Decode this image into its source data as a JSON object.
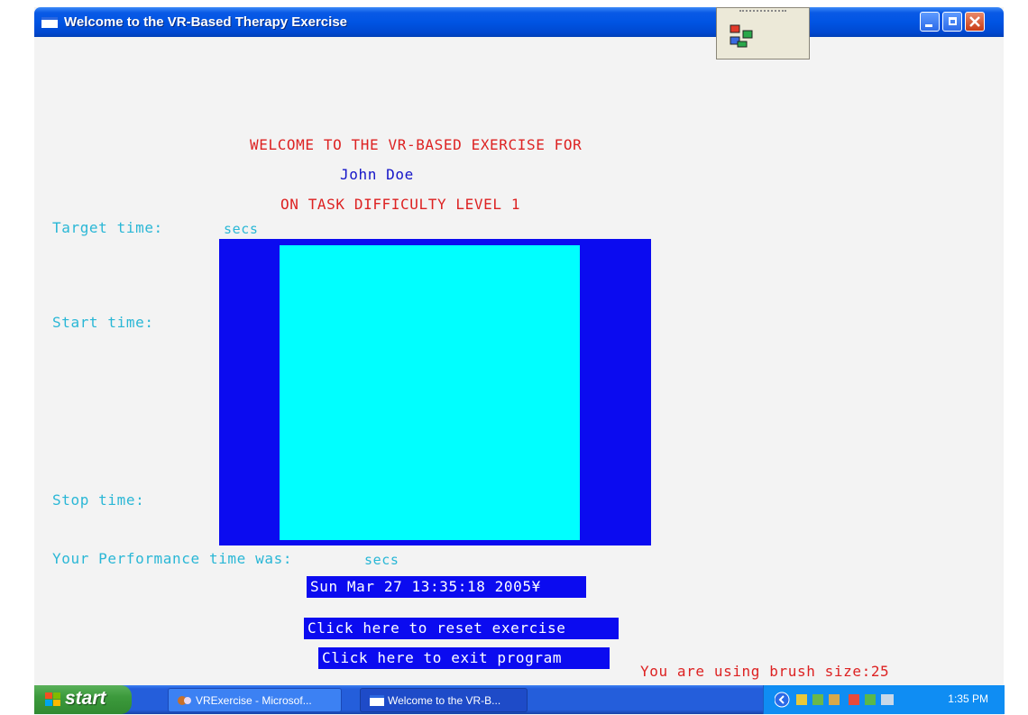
{
  "window": {
    "title": "Welcome to the VR-Based Therapy Exercise"
  },
  "welcome": {
    "heading": "WELCOME TO THE VR-BASED EXERCISE FOR",
    "user_name": "John Doe",
    "difficulty": "ON TASK DIFFICULTY LEVEL 1"
  },
  "timing": {
    "target_label": "Target time:",
    "target_unit": "secs",
    "start_label": "Start time:",
    "stop_label": "Stop time:",
    "performance_label": "Your Performance time was:",
    "performance_unit": "secs"
  },
  "datetime": "Sun Mar 27 13:35:18 2005¥",
  "buttons": {
    "reset": "Click here to reset exercise",
    "exit": "Click here to exit program"
  },
  "brush_status": "You are using brush size:25",
  "colors": {
    "canvas_border": "#0b0bf0",
    "canvas_fill": "#00ffff",
    "heading": "#dd2222",
    "label": "#2ab7d6"
  },
  "taskbar": {
    "start_label": "start",
    "tasks": [
      {
        "label": "VRExercise - Microsof...",
        "icon": "visual-studio-icon"
      },
      {
        "label": "Welcome to the VR-B...",
        "icon": "window-icon"
      }
    ],
    "clock": "1:35 PM"
  }
}
